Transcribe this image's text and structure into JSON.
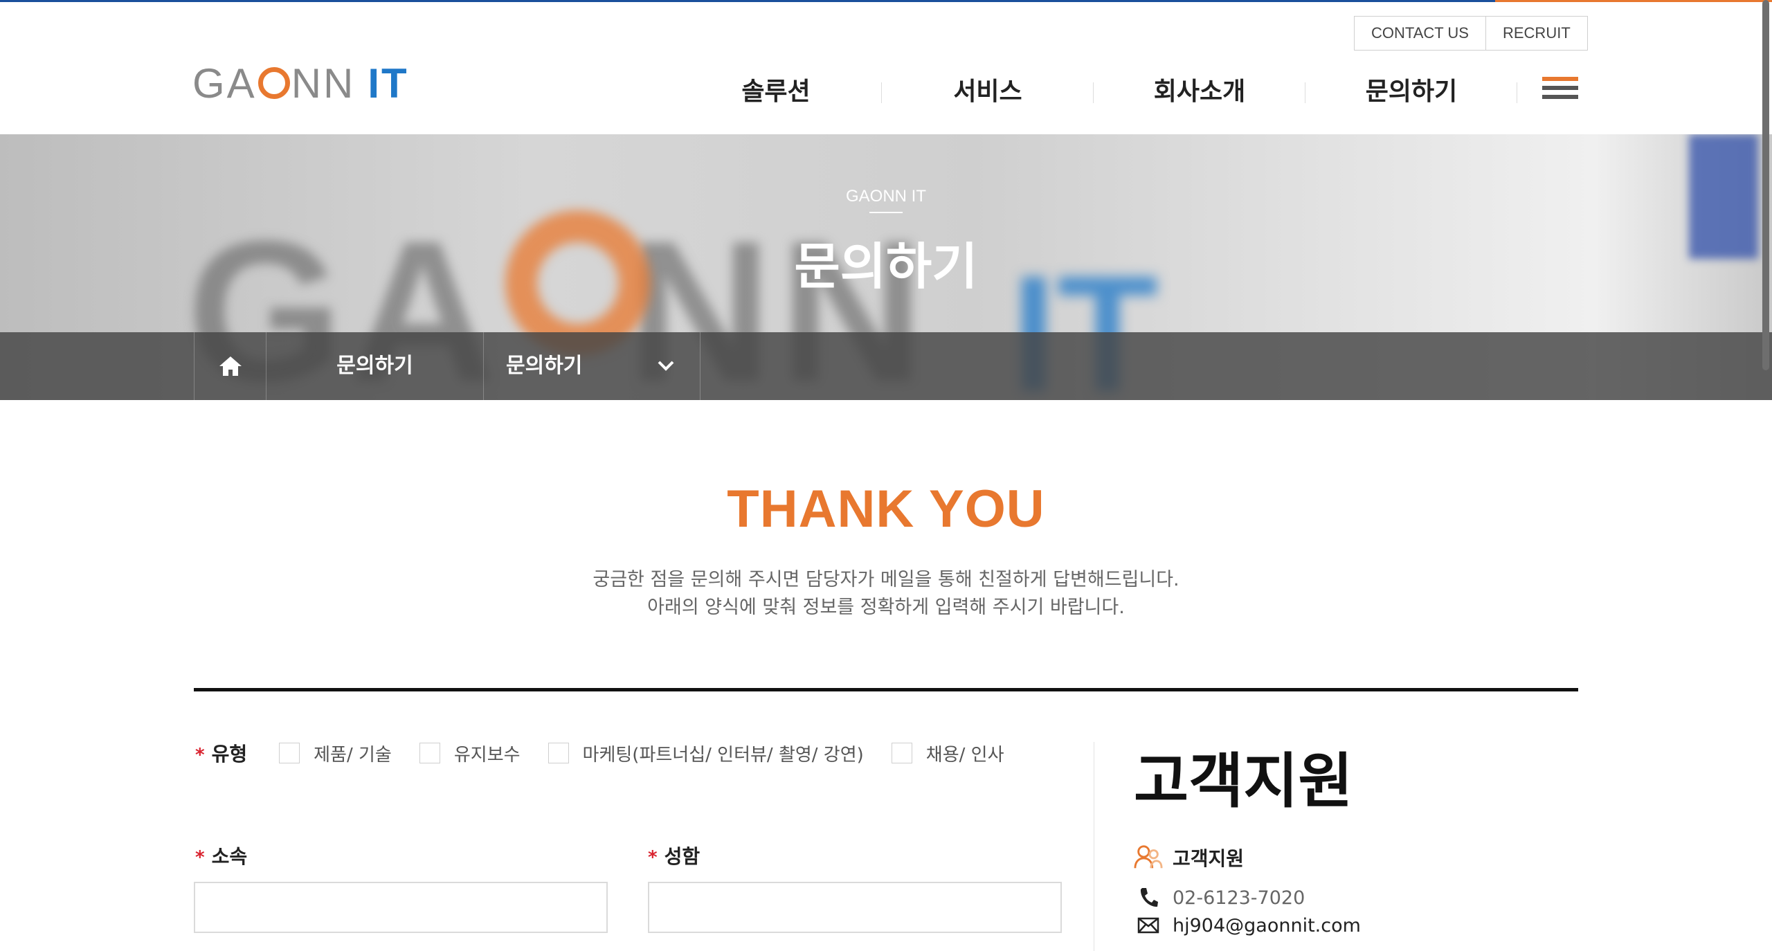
{
  "header": {
    "logo": {
      "part1": "GA",
      "part2": "NN",
      "part3": "IT"
    },
    "top_links": [
      "CONTACT US",
      "RECRUIT"
    ],
    "nav": [
      "솔루션",
      "서비스",
      "회사소개",
      "문의하기"
    ],
    "menu_icon": "hamburger-icon"
  },
  "hero": {
    "subtitle": "GAONN IT",
    "title": "문의하기",
    "background_text": "GAONN IT"
  },
  "breadcrumb": {
    "home_icon": "home-icon",
    "depth1": "문의하기",
    "depth2": "문의하기",
    "dropdown_icon": "chevron-down-icon"
  },
  "thanks": {
    "title": "THANK YOU",
    "line1": "궁금한 점을 문의해 주시면 담당자가 메일을 통해 친절하게 답변해드립니다.",
    "line2": "아래의 양식에 맞춰 정보를 정확하게 입력해 주시기 바랍니다."
  },
  "form": {
    "required_mark": "*",
    "type_label": "유형",
    "type_options": [
      "제품/ 기술",
      "유지보수",
      "마케팅(파트너십/ 인터뷰/ 촬영/ 강연)",
      "채용/ 인사"
    ],
    "affiliation_label": "소속",
    "affiliation_value": "",
    "name_label": "성함",
    "name_value": ""
  },
  "support": {
    "title": "고객지원",
    "heading": "고객지원",
    "phone": "02-6123-7020",
    "email": "hj904@gaonnit.com"
  },
  "colors": {
    "accent_orange": "#e8782f",
    "accent_blue": "#1f78c8",
    "required_red": "#d9232f"
  }
}
